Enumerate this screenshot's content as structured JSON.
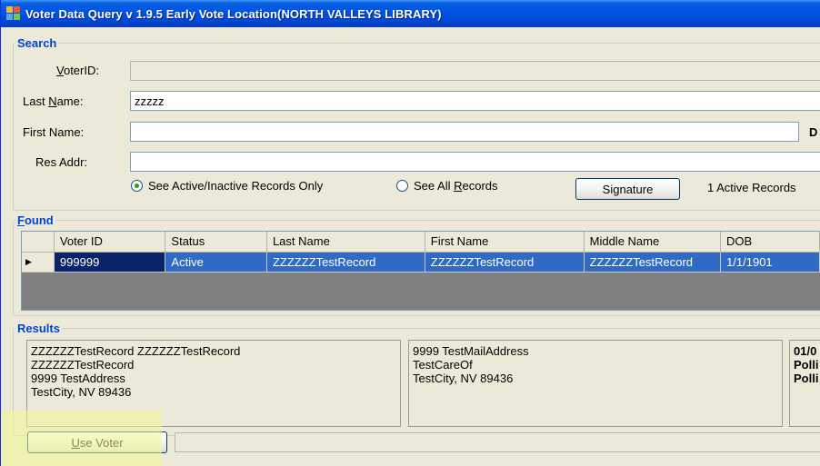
{
  "window": {
    "title": "Voter Data Query  v 1.9.5   Early Vote Location(NORTH VALLEYS LIBRARY)"
  },
  "search": {
    "legend": "Search",
    "voterid_label": "VoterID:",
    "voterid_value": "",
    "lastname_label": "Last Name:",
    "lastname_value": "zzzzz",
    "firstname_label": "First Name:",
    "firstname_value": "",
    "dob_label_partial": "D",
    "resaddr_label": "Res Addr:",
    "resaddr_value": "",
    "radio_active_label": "See Active/Inactive Records Only",
    "radio_all_label": "See All Records",
    "signature_label": "Signature",
    "record_count": "1 Active Records"
  },
  "found": {
    "legend": "Found",
    "columns": [
      "Voter ID",
      "Status",
      "Last Name",
      "First Name",
      "Middle Name",
      "DOB"
    ],
    "rows": [
      [
        "999999",
        "Active",
        "ZZZZZZTestRecord",
        "ZZZZZZTestRecord",
        "ZZZZZZTestRecord",
        "1/1/1901"
      ]
    ]
  },
  "results": {
    "legend": "Results",
    "box1": [
      "ZZZZZZTestRecord ZZZZZZTestRecord",
      "ZZZZZZTestRecord",
      "9999 TestAddress",
      "TestCity, NV  89436"
    ],
    "box2": [
      "9999 TestMailAddress",
      "TestCareOf",
      "TestCity, NV  89436"
    ],
    "box3": [
      "01/0",
      "Polli",
      "Polli"
    ]
  },
  "footer": {
    "use_voter_label": "Use Voter",
    "status_text": ""
  },
  "colors": {
    "title_bar": "#0055e5",
    "legend": "#0046d5",
    "selection": "#316ac5",
    "highlight": "#f2f896"
  }
}
